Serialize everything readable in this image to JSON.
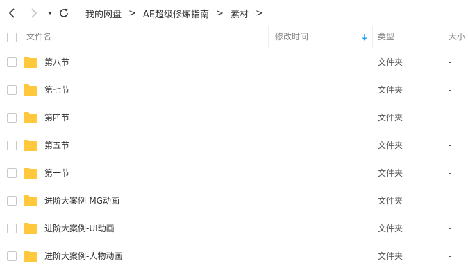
{
  "breadcrumb": [
    "我的网盘",
    "AE超级修炼指南",
    "素材"
  ],
  "breadcrumb_separator": ">",
  "columns": {
    "name": "文件名",
    "modified": "修改时间",
    "type": "类型",
    "size": "大小"
  },
  "sort_indicator": "arrow-down-icon",
  "rows": [
    {
      "name": "第八节",
      "type": "文件夹",
      "size": "-"
    },
    {
      "name": "第七节",
      "type": "文件夹",
      "size": "-"
    },
    {
      "name": "第四节",
      "type": "文件夹",
      "size": "-"
    },
    {
      "name": "第五节",
      "type": "文件夹",
      "size": "-"
    },
    {
      "name": "第一节",
      "type": "文件夹",
      "size": "-"
    },
    {
      "name": "进阶大案例-MG动画",
      "type": "文件夹",
      "size": "-"
    },
    {
      "name": "进阶大案例-UI动画",
      "type": "文件夹",
      "size": "-"
    },
    {
      "name": "进阶大案例-人物动画",
      "type": "文件夹",
      "size": "-"
    }
  ],
  "colors": {
    "folder": "#ffc83d",
    "sort_arrow": "#1e9fff"
  }
}
